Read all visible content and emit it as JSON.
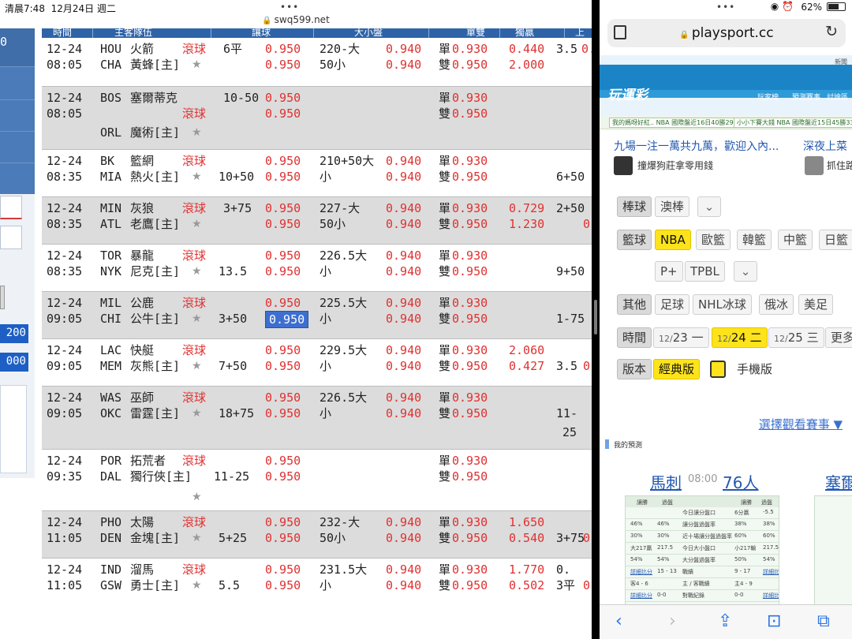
{
  "left": {
    "status_time": "清晨7:48",
    "status_date": "12月24日 週二",
    "url": "swq599.net",
    "sidebar_values": [
      "0",
      "200",
      "000"
    ],
    "header": [
      "時間",
      "主客隊伍",
      "讓球",
      "大小盤",
      "單雙",
      "獨贏",
      "上半"
    ],
    "rows": [
      {
        "date": "12-24",
        "time": "08:05",
        "t1c": "HOU",
        "t1n": "火箭",
        "t2c": "CHA",
        "t2n": "黃蜂[主]",
        "live": "滾球",
        "hcp1": "6平",
        "hcp2": "",
        "o1": "0.950",
        "o2": "0.950",
        "ou1": "220-大",
        "ou2": "50小",
        "oo1": "0.940",
        "oo2": "0.940",
        "s1": "單",
        "s1v": "0.930",
        "s2": "雙",
        "s2v": "0.950",
        "m1": "0.440",
        "m2": "2.000",
        "h1": "3.5",
        "h1v": "0.",
        "h2": "",
        "h2v": ""
      },
      {
        "date": "12-24",
        "time": "08:05",
        "t1c": "BOS",
        "t1n": "塞爾蒂克",
        "t2c": "ORL",
        "t2n": "魔術[主]",
        "live": "滾球",
        "hcp1": "10-50",
        "hcp2": "",
        "o1": "0.950",
        "o2": "0.950",
        "ou1": "",
        "ou2": "",
        "oo1": "",
        "oo2": "",
        "s1": "單",
        "s1v": "0.930",
        "s2": "雙",
        "s2v": "0.950",
        "m1": "",
        "m2": "",
        "h1": "",
        "h1v": "",
        "h2": "",
        "h2v": ""
      },
      {
        "date": "12-24",
        "time": "08:35",
        "t1c": "BK",
        "t1n": "籃網",
        "t2c": "MIA",
        "t2n": "熱火[主]",
        "live": "滾球",
        "hcp1": "",
        "hcp2": "10+50",
        "o1": "0.950",
        "o2": "0.950",
        "ou1": "210+50大",
        "ou2": "小",
        "oo1": "0.940",
        "oo2": "0.940",
        "s1": "單",
        "s1v": "0.930",
        "s2": "雙",
        "s2v": "0.950",
        "m1": "",
        "m2": "",
        "h1": "",
        "h1v": "",
        "h2": "6+50",
        "h2v": ""
      },
      {
        "date": "12-24",
        "time": "08:35",
        "t1c": "MIN",
        "t1n": "灰狼",
        "t2c": "ATL",
        "t2n": "老鷹[主]",
        "live": "滾球",
        "hcp1": "3+75",
        "hcp2": "",
        "o1": "0.950",
        "o2": "0.950",
        "ou1": "227-大",
        "ou2": "50小",
        "oo1": "0.940",
        "oo2": "0.940",
        "s1": "單",
        "s1v": "0.930",
        "s2": "雙",
        "s2v": "0.950",
        "m1": "0.729",
        "m2": "1.230",
        "h1": "2+50",
        "h1v": "",
        "h2": "",
        "h2v": "0"
      },
      {
        "date": "12-24",
        "time": "08:35",
        "t1c": "TOR",
        "t1n": "暴龍",
        "t2c": "NYK",
        "t2n": "尼克[主]",
        "live": "滾球",
        "hcp1": "",
        "hcp2": "13.5",
        "o1": "0.950",
        "o2": "0.950",
        "ou1": "226.5大",
        "ou2": "小",
        "oo1": "0.940",
        "oo2": "0.940",
        "s1": "單",
        "s1v": "0.930",
        "s2": "雙",
        "s2v": "0.950",
        "m1": "",
        "m2": "",
        "h1": "",
        "h1v": "",
        "h2": "9+50",
        "h2v": ""
      },
      {
        "date": "12-24",
        "time": "09:05",
        "t1c": "MIL",
        "t1n": "公鹿",
        "t2c": "CHI",
        "t2n": "公牛[主]",
        "live": "滾球",
        "hcp1": "",
        "hcp2": "3+50",
        "o1": "0.950",
        "o2": "0.950",
        "ou1": "225.5大",
        "ou2": "小",
        "oo1": "0.940",
        "oo2": "0.940",
        "s1": "單",
        "s1v": "0.930",
        "s2": "雙",
        "s2v": "0.950",
        "m1": "",
        "m2": "",
        "h1": "",
        "h1v": "",
        "h2": "1-75",
        "h2v": ""
      },
      {
        "date": "12-24",
        "time": "09:05",
        "t1c": "LAC",
        "t1n": "快艇",
        "t2c": "MEM",
        "t2n": "灰熊[主]",
        "live": "滾球",
        "hcp1": "",
        "hcp2": "7+50",
        "o1": "0.950",
        "o2": "0.950",
        "ou1": "229.5大",
        "ou2": "小",
        "oo1": "0.940",
        "oo2": "0.940",
        "s1": "單",
        "s1v": "0.930",
        "s2": "雙",
        "s2v": "0.950",
        "m1": "2.060",
        "m2": "0.427",
        "h1": "",
        "h1v": "",
        "h2": "3.5",
        "h2v": "0."
      },
      {
        "date": "12-24",
        "time": "09:05",
        "t1c": "WAS",
        "t1n": "巫師",
        "t2c": "OKC",
        "t2n": "雷霆[主]",
        "live": "滾球",
        "hcp1": "",
        "hcp2": "18+75",
        "o1": "0.950",
        "o2": "0.950",
        "ou1": "226.5大",
        "ou2": "小",
        "oo1": "0.940",
        "oo2": "0.940",
        "s1": "單",
        "s1v": "0.930",
        "s2": "雙",
        "s2v": "0.950",
        "m1": "",
        "m2": "",
        "h1": "",
        "h1v": "",
        "h2": "11-",
        "h2v": "25"
      },
      {
        "date": "12-24",
        "time": "09:35",
        "t1c": "POR",
        "t1n": "拓荒者",
        "t2c": "DAL",
        "t2n": "獨行俠[主]",
        "live": "滾球",
        "hcp1": "",
        "hcp2": "11-25",
        "o1": "0.950",
        "o2": "0.950",
        "ou1": "",
        "ou2": "",
        "oo1": "",
        "oo2": "",
        "s1": "單",
        "s1v": "0.930",
        "s2": "雙",
        "s2v": "0.950",
        "m1": "",
        "m2": "",
        "h1": "",
        "h1v": "",
        "h2": "",
        "h2v": ""
      },
      {
        "date": "12-24",
        "time": "11:05",
        "t1c": "PHO",
        "t1n": "太陽",
        "t2c": "DEN",
        "t2n": "金塊[主]",
        "live": "滾球",
        "hcp1": "",
        "hcp2": "5+25",
        "o1": "0.950",
        "o2": "0.950",
        "ou1": "232-大",
        "ou2": "50小",
        "oo1": "0.940",
        "oo2": "0.940",
        "s1": "單",
        "s1v": "0.930",
        "s2": "雙",
        "s2v": "0.950",
        "m1": "1.650",
        "m2": "0.540",
        "h1": "",
        "h1v": "",
        "h2": "3+75",
        "h2v": "0"
      },
      {
        "date": "12-24",
        "time": "11:05",
        "t1c": "IND",
        "t1n": "溜馬",
        "t2c": "GSW",
        "t2n": "勇士[主]",
        "live": "滾球",
        "hcp1": "",
        "hcp2": "5.5",
        "o1": "0.950",
        "o2": "0.950",
        "ou1": "231.5大",
        "ou2": "小",
        "oo1": "0.940",
        "oo2": "0.940",
        "s1": "單",
        "s1v": "0.930",
        "s2": "雙",
        "s2v": "0.950",
        "m1": "1.770",
        "m2": "0.502",
        "h1": "0.",
        "h1v": "",
        "h2": "3平",
        "h2v": "0."
      }
    ]
  },
  "right": {
    "status_pct": "62%",
    "domain": "playsport.cc",
    "logo": "玩運彩",
    "banner_toplink": "新聞",
    "nav": [
      "玩家榜",
      "預測賽事",
      "討論區"
    ],
    "ticker": [
      "我的媽呀好紅.. NBA 國際盤近16日40勝29",
      "小小下賽大錢 NBA 國際盤近15日45勝33"
    ],
    "article1": "九場一注一萬共九萬，歡迎入內...",
    "article2": "深夜上菜",
    "author1": "撞爆狗莊拿零用錢",
    "author2": "抓住路",
    "filters": {
      "baseball_label": "棒球",
      "baseball": [
        "澳棒"
      ],
      "basketball_label": "籃球",
      "basketball": [
        "NBA",
        "歐籃",
        "韓籃",
        "中籃",
        "日籃"
      ],
      "basketball2": [
        "P+",
        "TPBL"
      ],
      "other_label": "其他",
      "other": [
        "足球",
        "NHL冰球",
        "俄冰",
        "美足"
      ],
      "time_label": "時間",
      "times": [
        {
          "d": "12/",
          "n": "23",
          "w": "一"
        },
        {
          "d": "12/",
          "n": "24",
          "w": "二"
        },
        {
          "d": "12/",
          "n": "25",
          "w": "三"
        }
      ],
      "more": "更多",
      "version_label": "版本",
      "classic": "經典版",
      "mobile": "手機版"
    },
    "select_game": "選擇觀看賽事 ▼",
    "my_prediction": "我的預測",
    "matchup": {
      "away": "馬刺",
      "time": "08:00",
      "home": "76人",
      "next": "塞爾"
    },
    "stats": {
      "h_left": "讓勝",
      "h_left2": "過盤",
      "h_right": "讓勝",
      "h_right2": "過盤",
      "rows": [
        [
          "",
          "",
          "今日讓分盤口",
          "6分贏",
          "-5.5"
        ],
        [
          "46%",
          "46%",
          "讓分盤過盤率",
          "38%",
          "38%"
        ],
        [
          "30%",
          "30%",
          "近十場讓分盤過盤率",
          "60%",
          "60%"
        ],
        [
          "大217贏",
          "217.5",
          "今日大小盤口",
          "小217輸",
          "217.5"
        ],
        [
          "54%",
          "54%",
          "大分盤過盤率",
          "50%",
          "54%"
        ],
        [
          "詳細比分",
          "15 - 13",
          "戰績",
          "9 - 17",
          "詳細比分"
        ],
        [
          "客4 - 6",
          "",
          "主 / 客戰績",
          "主4 - 9",
          ""
        ],
        [
          "詳細比分",
          "0-0",
          "對戰紀錄",
          "0-0",
          "詳細比分"
        ]
      ]
    }
  }
}
